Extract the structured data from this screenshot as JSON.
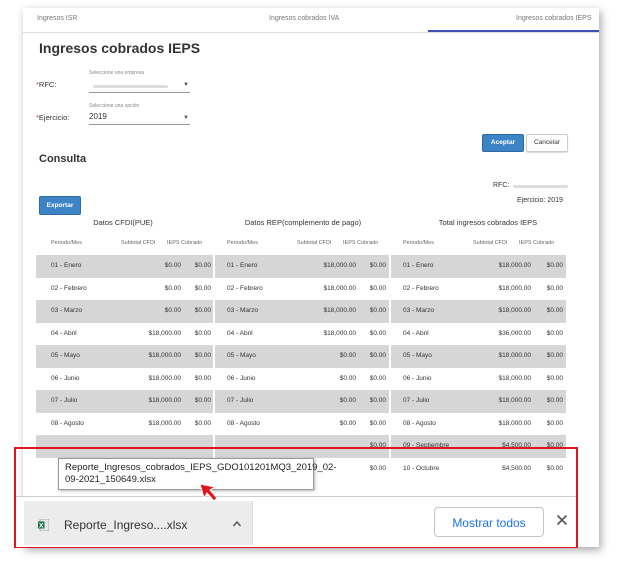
{
  "tabs": [
    "Ingresos ISR",
    "Ingresos cobrados IVA",
    "Ingresos cobrados IEPS"
  ],
  "page_title": "Ingresos cobrados IEPS",
  "form": {
    "rfc_label": "RFC:",
    "rfc_hint": "Seleccione una empresa",
    "ejercicio_label": "Ejercicio:",
    "ejercicio_hint": "Seleccione una opción",
    "ejercicio_value": "2019"
  },
  "buttons": {
    "accept": "Aceptar",
    "cancel": "Cancelar",
    "export": "Exportar"
  },
  "section_title": "Consulta",
  "meta": {
    "rfc_label": "RFC:",
    "ejercicio": "Ejercicio: 2019"
  },
  "groups": [
    "Datos CFDI(PUE)",
    "Datos REP(complemento de pago)",
    "Total ingresos cobrados IEPS"
  ],
  "column_headers": [
    "Periodo/Mes",
    "Subtotal CFDI",
    "IEPS Cobrado",
    "Periodo/Mes",
    "Subtotal CFDI",
    "IEPS Cobrado",
    "Periodo/Mes",
    "Subtotal CFDI",
    "IEPS Cobrado"
  ],
  "rows": [
    [
      "01 - Enero",
      "$0.00",
      "$0.00",
      "01 - Enero",
      "$18,000.00",
      "$0.00",
      "01 - Enero",
      "$18,000.00",
      "$0.00"
    ],
    [
      "02 - Febrero",
      "$0.00",
      "$0.00",
      "02 - Febrero",
      "$18,000.00",
      "$0.00",
      "02 - Febrero",
      "$18,000.00",
      "$0.00"
    ],
    [
      "03 - Marzo",
      "$0.00",
      "$0.00",
      "03 - Marzo",
      "$18,000.00",
      "$0.00",
      "03 - Marzo",
      "$18,000.00",
      "$0.00"
    ],
    [
      "04 - Abril",
      "$18,000.00",
      "$0.00",
      "04 - Abril",
      "$18,000.00",
      "$0.00",
      "04 - Abril",
      "$36,000.00",
      "$0.00"
    ],
    [
      "05 - Mayo",
      "$18,000.00",
      "$0.00",
      "05 - Mayo",
      "$0.00",
      "$0.00",
      "05 - Mayo",
      "$18,000.00",
      "$0.00"
    ],
    [
      "06 - Junio",
      "$18,000.00",
      "$0.00",
      "06 - Junio",
      "$0.00",
      "$0.00",
      "06 - Junio",
      "$18,000.00",
      "$0.00"
    ],
    [
      "07 - Julio",
      "$18,000.00",
      "$0.00",
      "07 - Julio",
      "$0.00",
      "$0.00",
      "07 - Julio",
      "$18,000.00",
      "$0.00"
    ],
    [
      "08 - Agosto",
      "$18,000.00",
      "$0.00",
      "08 - Agosto",
      "$0.00",
      "$0.00",
      "08 - Agosto",
      "$18,000.00",
      "$0.00"
    ],
    [
      "",
      "",
      "",
      "",
      "",
      "$0.00",
      "09 - Septiembre",
      "$4,500.00",
      "$0.00"
    ],
    [
      "",
      "",
      "",
      "",
      "",
      "$0.00",
      "10 - Octubre",
      "$4,500.00",
      "$0.00"
    ]
  ],
  "tooltip_text": "Reporte_Ingresos_cobrados_IEPS_GDO101201MQ3_2019_02-09-2021_150649.xlsx",
  "download": {
    "file_label": "Reporte_Ingreso....xlsx",
    "show_all": "Mostrar todos"
  },
  "colors": {
    "accent": "#3d84c6",
    "highlight": "#e0161c",
    "link": "#1a73e8",
    "row_shade": "#d6d6d6"
  }
}
